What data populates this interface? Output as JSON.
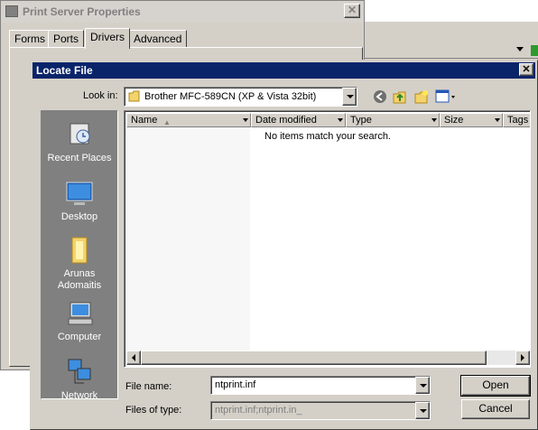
{
  "background_window": {
    "title": "Print Server Properties",
    "tabs": [
      "Forms",
      "Ports",
      "Drivers",
      "Advanced"
    ],
    "active_tab": "Drivers"
  },
  "dialog": {
    "title": "Locate File",
    "look_in_label": "Look in:",
    "look_in_value": "Brother MFC-589CN (XP & Vista 32bit)",
    "places": [
      "Recent Places",
      "Desktop",
      "Arunas Adomaitis",
      "Computer",
      "Network"
    ],
    "columns": [
      "Name",
      "Date modified",
      "Type",
      "Size",
      "Tags"
    ],
    "empty_message": "No items match your search.",
    "file_name_label": "File name:",
    "file_name_value": "ntprint.inf",
    "files_of_type_label": "Files of type:",
    "files_of_type_value": "ntprint.inf;ntprint.in_",
    "open_label": "Open",
    "cancel_label": "Cancel"
  },
  "colors": {
    "titlebar": "#0a246a",
    "face": "#d4d0c8",
    "places_bg": "#808080"
  }
}
